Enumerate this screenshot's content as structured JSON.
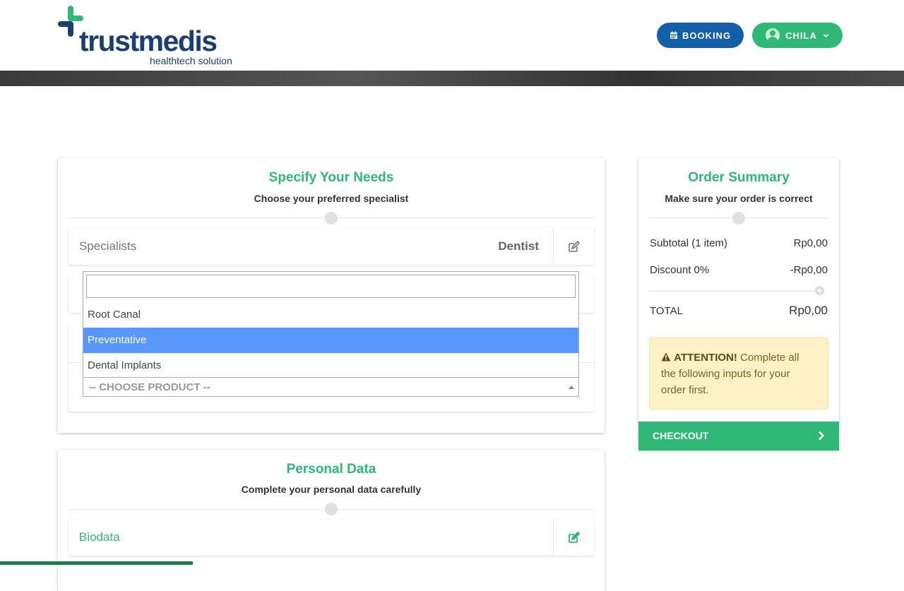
{
  "brand": {
    "name": "trustmedis",
    "tagline": "healthtech solution"
  },
  "header": {
    "booking_label": "BOOKING",
    "user_label": "CHILA"
  },
  "needs": {
    "title": "Specify Your Needs",
    "subtitle": "Choose your preferred specialist",
    "specialist_label": "Specialists",
    "specialist_value": "Dentist"
  },
  "product_dropdown": {
    "search_value": "",
    "options": [
      "Root Canal",
      "Preventative",
      "Dental Implants"
    ],
    "highlighted": "Preventative",
    "placeholder": "-- CHOOSE PRODUCT --"
  },
  "personal": {
    "title": "Personal Data",
    "subtitle": "Complete your personal data carefully",
    "biodata_label": "Biodata"
  },
  "summary": {
    "title": "Order Summary",
    "subtitle": "Make sure your order is correct",
    "subtotal_label": "Subtotal (1 item)",
    "subtotal_value": "Rp0,00",
    "discount_label": "Discount 0%",
    "discount_value": "-Rp0,00",
    "total_label": "TOTAL",
    "total_value": "Rp0,00",
    "attention_strong": "ATTENTION!",
    "attention_text": " Complete all the following inputs for your order first.",
    "checkout_label": "CHECKOUT"
  },
  "colors": {
    "brand_green": "#2fb876",
    "brand_blue": "#135fa8",
    "highlight": "#5897fb",
    "warning_bg": "#fdf1c5"
  },
  "icons": [
    "calendar-icon",
    "chevron-down-icon",
    "edit-icon",
    "plus-circle-icon",
    "warning-icon",
    "chevron-right-icon"
  ]
}
